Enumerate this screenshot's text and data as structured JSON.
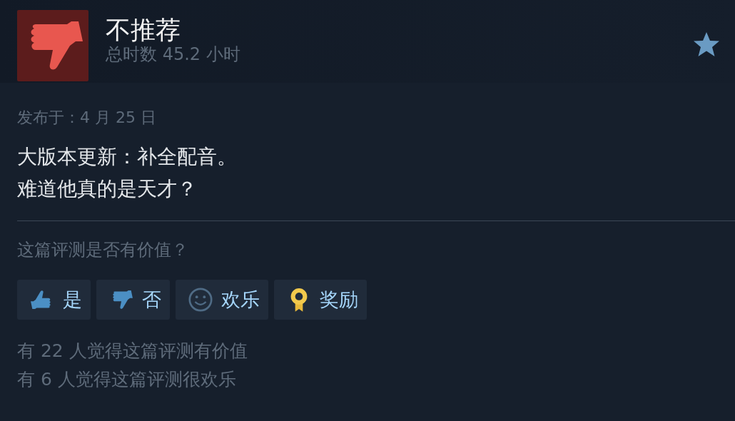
{
  "review": {
    "recommended": false,
    "verdict": "不推荐",
    "playtime": "总时数 45.2 小时",
    "posted": "发布于：4 月 25 日",
    "body_lines": [
      "大版本更新：补全配音。",
      "难道他真的是天才？"
    ]
  },
  "helpful_prompt": "这篇评测是否有价值？",
  "buttons": [
    {
      "kind": "yes",
      "label": "是"
    },
    {
      "kind": "no",
      "label": "否"
    },
    {
      "kind": "funny",
      "label": "欢乐"
    },
    {
      "kind": "award",
      "label": "奖励"
    }
  ],
  "stats": [
    "有 22 人觉得这篇评测有价值",
    "有 6 人觉得这篇评测很欢乐"
  ]
}
